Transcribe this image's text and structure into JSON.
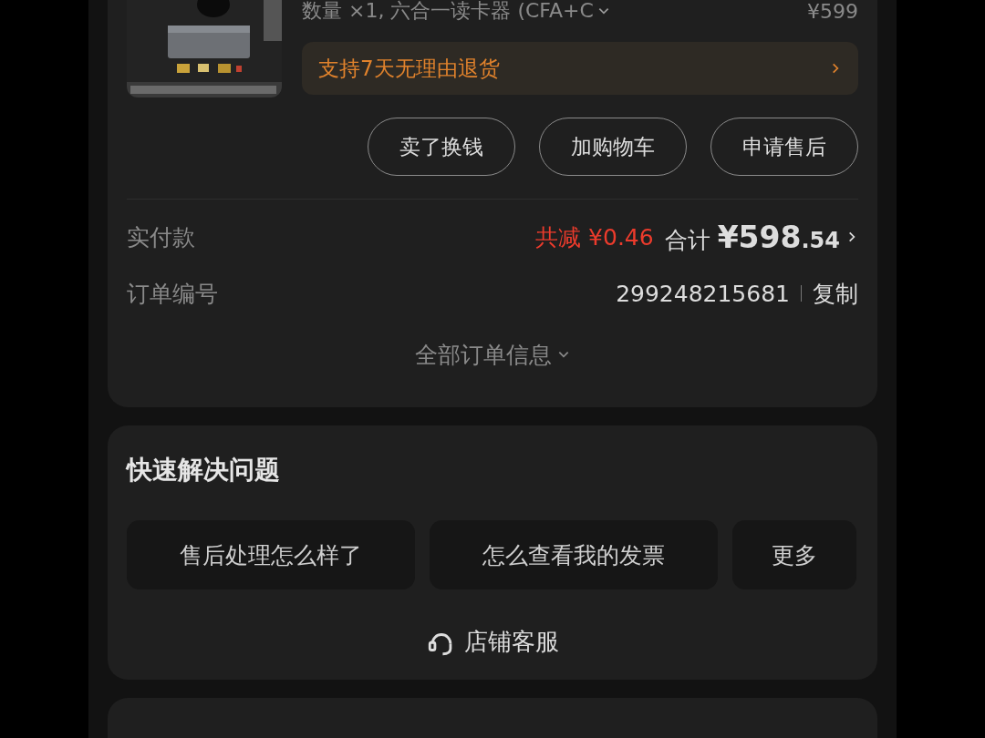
{
  "order": {
    "product": {
      "spec": "数量 ×1, 六合一读卡器 (CFA+C",
      "price": "¥599"
    },
    "return_policy": "支持7天无理由退货",
    "actions": [
      "卖了换钱",
      "加购物车",
      "申请售后"
    ],
    "paid": {
      "label": "实付款",
      "discount": "共减 ¥0.46",
      "total_label": "合计",
      "total_currency": "¥",
      "total_integer": "598",
      "total_decimal": ".54"
    },
    "order_no": {
      "label": "订单编号",
      "value": "299248215681",
      "copy": "复制"
    },
    "all_info": "全部订单信息"
  },
  "quick": {
    "title": "快速解决问题",
    "chips": [
      "售后处理怎么样了",
      "怎么查看我的发票",
      "更多"
    ],
    "service": "店铺客服"
  }
}
